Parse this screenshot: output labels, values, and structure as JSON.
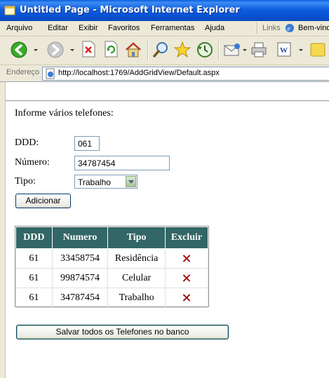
{
  "window": {
    "title": "Untitled Page - Microsoft Internet Explorer"
  },
  "menu": {
    "items": [
      {
        "label": "Arquivo"
      },
      {
        "label": "Editar"
      },
      {
        "label": "Exibir"
      },
      {
        "label": "Favoritos"
      },
      {
        "label": "Ferramentas"
      },
      {
        "label": "Ajuda"
      }
    ],
    "links_label": "Links",
    "links_item": "Bem-vindo"
  },
  "toolbar": {
    "buttons": [
      "back-icon",
      "forward-icon",
      "stop-icon",
      "refresh-icon",
      "home-icon",
      "search-icon",
      "favorites-icon",
      "history-icon",
      "mail-icon",
      "print-icon",
      "edit-icon",
      "messenger-icon"
    ]
  },
  "address": {
    "label": "Endereço",
    "url": "http://localhost:1769/AddGridView/Default.aspx"
  },
  "form": {
    "heading": "Informe vários telefones:",
    "ddd_label": "DDD:",
    "ddd_value": "061",
    "numero_label": "Número:",
    "numero_value": "34787454",
    "tipo_label": "Tipo:",
    "tipo_value": "Trabalho",
    "add_button": "Adicionar"
  },
  "grid": {
    "headers": [
      "DDD",
      "Numero",
      "Tipo",
      "Excluir"
    ],
    "rows": [
      {
        "ddd": "61",
        "numero": "33458754",
        "tipo": "Residência"
      },
      {
        "ddd": "61",
        "numero": "99874574",
        "tipo": "Celular"
      },
      {
        "ddd": "61",
        "numero": "34787454",
        "tipo": "Trabalho"
      }
    ],
    "header_color": "#336666",
    "delete_color": "#a01111"
  },
  "save_button": "Salvar todos os Telefones no banco"
}
